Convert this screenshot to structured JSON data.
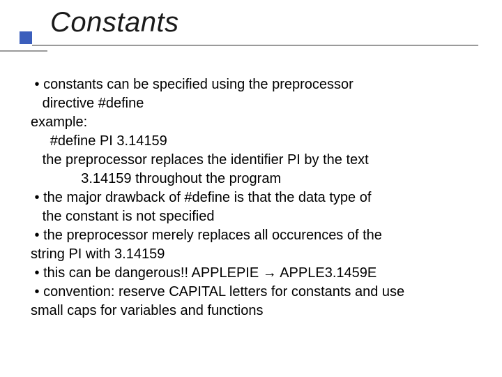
{
  "title": "Constants",
  "lines": {
    "l1": " • constants can be specified using the preprocessor",
    "l2": "   directive #define",
    "l3": "example:",
    "l4": "     #define PI 3.14159",
    "l5": "   the preprocessor replaces the identifier PI by the text",
    "l6": "             3.14159 throughout the program",
    "l7": " • the major drawback of #define is that the data type of",
    "l8": "   the constant is not specified",
    "l9": " • the preprocessor merely replaces all occurences of the",
    "l10": "string PI with 3.14159",
    "l11a": " • this can be dangerous!! APPLEPIE ",
    "l11b": " APPLE3.1459E",
    "l12": " • convention: reserve CAPITAL letters for constants and use",
    "l13": "small caps for variables and functions"
  }
}
